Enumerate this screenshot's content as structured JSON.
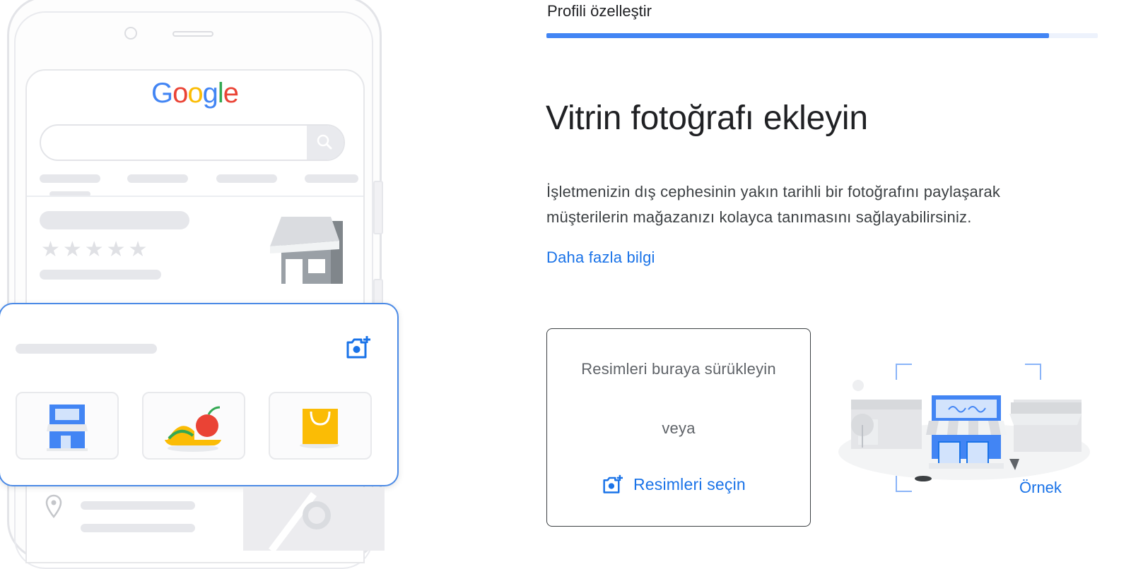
{
  "illustration": {
    "logo_letters": [
      "G",
      "o",
      "o",
      "g",
      "l",
      "e"
    ],
    "logo_colors": [
      "#4285f4",
      "#ea4335",
      "#fbbc05",
      "#4285f4",
      "#34a853",
      "#ea4335"
    ],
    "stars": "★★★★★",
    "star_rating": 0,
    "card_thumbnails": [
      "storefront-icon",
      "food-icon",
      "shopping-bag-icon"
    ]
  },
  "header": {
    "step_title": "Profili özelleştir",
    "progress": 0.911
  },
  "main": {
    "heading": "Vitrin fotoğrafı ekleyin",
    "description": "İşletmenizin dış cephesinin yakın tarihli bir fotoğrafını paylaşarak müşterilerin mağazanızı kolayca tanımasını sağlayabilirsiniz.",
    "learn_more": "Daha fazla bilgi"
  },
  "upload": {
    "drag_text": "Resimleri buraya sürükleyin",
    "or_text": "veya",
    "select_label": "Resimleri seçin"
  },
  "example": {
    "label": "Örnek"
  },
  "colors": {
    "accent": "#1a73e8",
    "progress": "#4285f4",
    "text_primary": "#202124",
    "text_secondary": "#5f6368"
  }
}
